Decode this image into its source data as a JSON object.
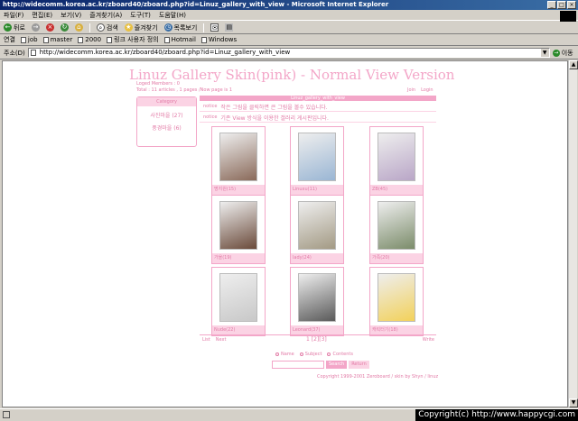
{
  "window": {
    "title": "http://widecomm.korea.ac.kr/zboard40/zboard.php?id=Linuz_gallery_with_view - Microsoft Internet Explorer",
    "controls": [
      "_",
      "□",
      "×"
    ]
  },
  "menu": {
    "items": [
      "파일(F)",
      "편집(E)",
      "보기(V)",
      "즐겨찾기(A)",
      "도구(T)",
      "도움말(H)"
    ]
  },
  "toolbar": {
    "back": "뒤로",
    "search": "검색",
    "favorites": "즐겨찾기",
    "history": "목록보기"
  },
  "links": {
    "label": "연결",
    "items": [
      "job",
      "master",
      "2000",
      "링크 사용자 정의",
      "Hotmail",
      "Windows"
    ]
  },
  "address": {
    "label": "주소(D)",
    "url": "http://widecomm.korea.ac.kr/zboard40/zboard.php?id=Linuz_gallery_with_view",
    "go": "이동"
  },
  "gallery": {
    "title": "Linuz Gallery Skin(pink) - Normal View Version",
    "logged_members": "Loged Members : 0",
    "totals": "Total : 11 articles , 1 pages /Now page is 1",
    "login_links": [
      "Join",
      "Login"
    ],
    "category_header": "Category",
    "categories": [
      "사진마을 (27)",
      "풍경마을 (6)"
    ],
    "board_header": "Linuz_gallery_with_view",
    "notices": [
      {
        "tag": "notice",
        "text": "작은 그림을 클릭하면 큰 그림을 볼수 있습니다."
      },
      {
        "tag": "notice",
        "text": "기존 View 방식을 이용한 갤러리 게시판입니다."
      }
    ],
    "thumbs": [
      {
        "caption": "명지원(15)",
        "color": "#8a6a5a"
      },
      {
        "caption": "Linuxu(11)",
        "color": "#9ab6d4"
      },
      {
        "caption": "ZB(45)",
        "color": "#b9a6c7"
      },
      {
        "caption": "가을(19)",
        "color": "#6a4a3a"
      },
      {
        "caption": "lady(24)",
        "color": "#a39a84"
      },
      {
        "caption": "가족(20)",
        "color": "#7b8c6a"
      },
      {
        "caption": "Nude(22)",
        "color": "#c8c8c8"
      },
      {
        "caption": "Leonard(37)",
        "color": "#5a5a5a"
      },
      {
        "caption": "캐릭터기(18)",
        "color": "#f2d15a"
      }
    ],
    "footer": {
      "list": "List",
      "next": "Next",
      "pages": "1 [2][3]",
      "write": "Write"
    },
    "search_options": [
      "Name",
      "Subject",
      "Contents"
    ],
    "search_button": "Search",
    "cancel_button": "Return",
    "copyright": "Copyright 1999-2001 Zeroboard / skin by Shyn / linuz"
  },
  "status": {
    "watermark": "Copyright(c) http://www.happycgi.com"
  }
}
